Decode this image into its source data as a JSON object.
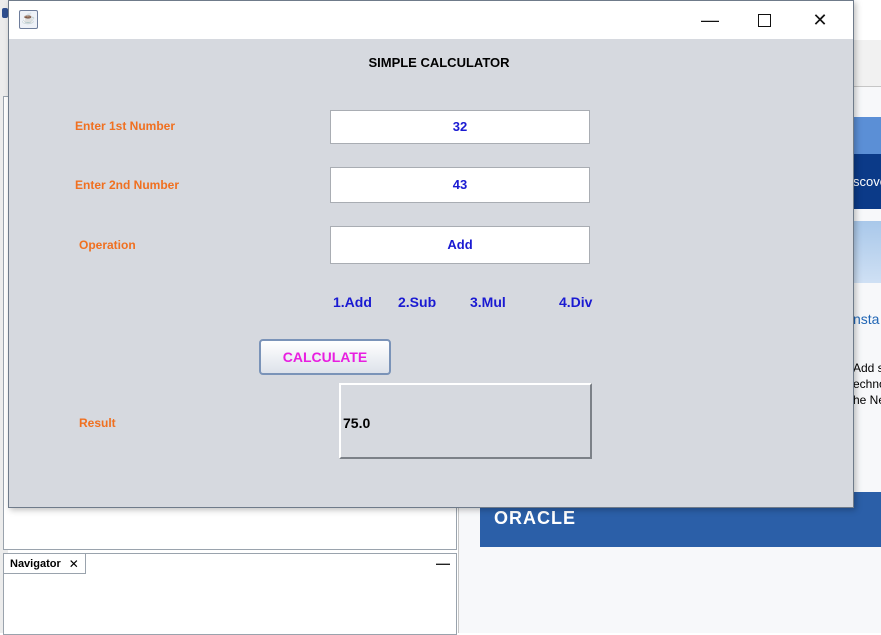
{
  "window": {
    "controls": {
      "minimize": "—",
      "close": "✕"
    }
  },
  "calculator": {
    "title": "SIMPLE CALCULATOR",
    "first_label": "Enter 1st Number",
    "first_value": "32",
    "second_label": "Enter 2nd Number",
    "second_value": "43",
    "operation_label": "Operation",
    "operation_value": "Add",
    "options": [
      "1.Add",
      "2.Sub",
      "3.Mul",
      "4.Div"
    ],
    "calculate_label": "CALCULATE",
    "result_label": "Result",
    "result_value": "75.0"
  },
  "background_ide": {
    "navigator_tab": "Navigator",
    "navigator_close": "✕",
    "navigator_minimize": "—",
    "banner_text": "scove",
    "install_link": "nsta",
    "body_lines": [
      "Add su",
      "echno",
      "he Ne"
    ],
    "oracle_logo": "ORACLE"
  },
  "colors": {
    "label": "#f07020",
    "field_text": "#1a1ad2",
    "button_text": "#e81ee0",
    "window_bg": "#d6d9df"
  }
}
